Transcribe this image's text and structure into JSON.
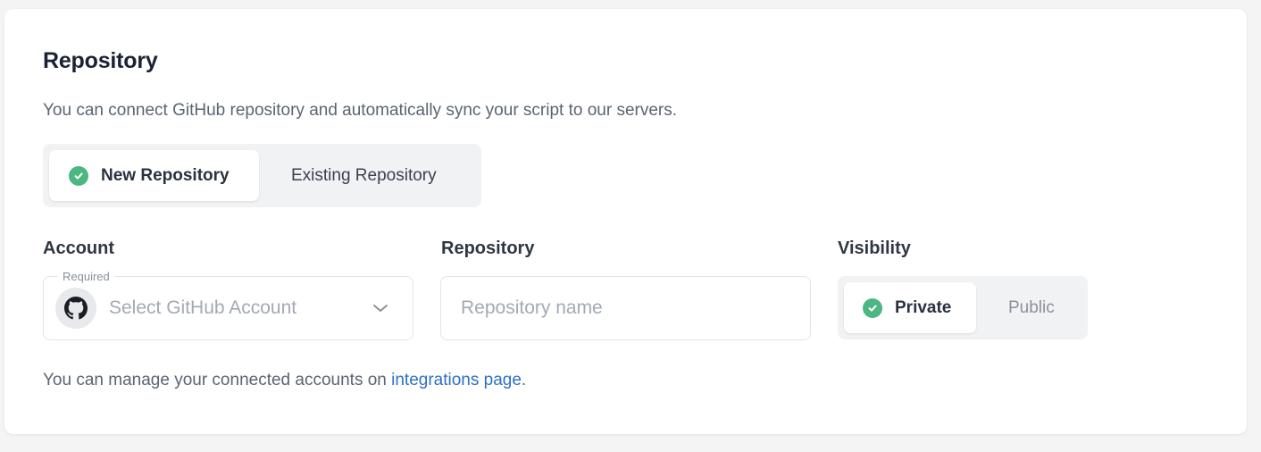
{
  "section": {
    "title": "Repository",
    "description": "You can connect GitHub repository and automatically sync your script to our servers."
  },
  "repo_mode": {
    "options": [
      {
        "label": "New Repository",
        "selected": true
      },
      {
        "label": "Existing Repository",
        "selected": false
      }
    ]
  },
  "account": {
    "label": "Account",
    "required_label": "Required",
    "placeholder": "Select GitHub Account",
    "icon": "github-icon"
  },
  "repository": {
    "label": "Repository",
    "placeholder": "Repository name"
  },
  "visibility": {
    "label": "Visibility",
    "options": [
      {
        "label": "Private",
        "selected": true
      },
      {
        "label": "Public",
        "selected": false
      }
    ]
  },
  "footer": {
    "text": "You can manage your connected accounts on ",
    "link_text": "integrations page",
    "suffix": "."
  },
  "colors": {
    "accent_green": "#4cb782",
    "link_blue": "#2f6fc4",
    "title": "#1a2233"
  }
}
